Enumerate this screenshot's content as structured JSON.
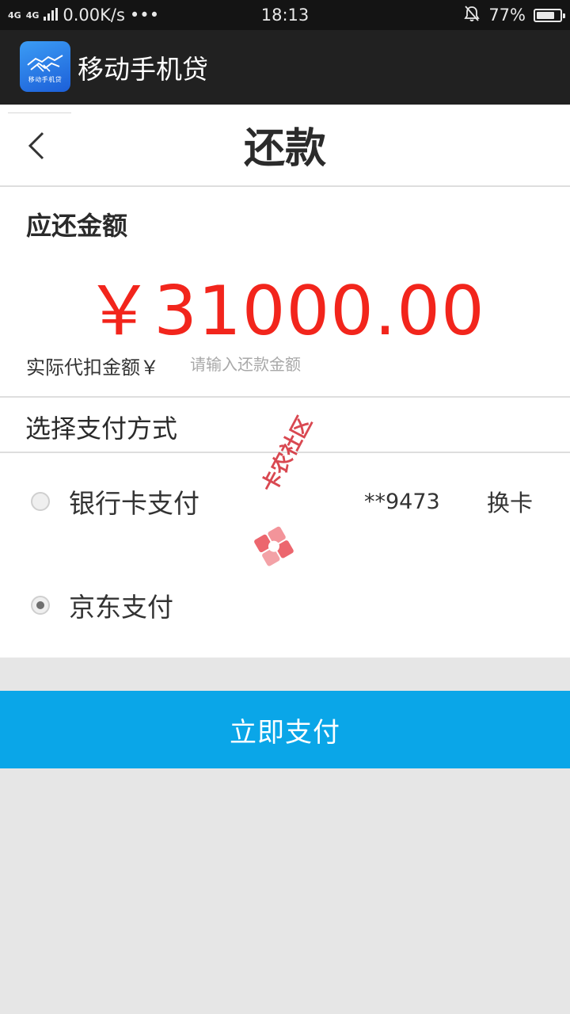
{
  "status_bar": {
    "network": "4G",
    "network2": "4G",
    "speed": "0.00K/s",
    "more": "•••",
    "time": "18:13",
    "battery": "77%",
    "battery_level": 0.77
  },
  "app_bar": {
    "title": "移动手机贷",
    "logo_text": "移动手机贷"
  },
  "page": {
    "title": "还款"
  },
  "amount": {
    "label": "应还金额",
    "value": "￥31000.00",
    "actual_label": "实际代扣金额￥",
    "actual_input_value": "",
    "actual_placeholder": "请输入还款金额"
  },
  "payment": {
    "header": "选择支付方式",
    "options": [
      {
        "label": "银行卡支付",
        "card_number": "**9473",
        "change_label": "换卡",
        "selected": false
      },
      {
        "label": "京东支付",
        "selected": true
      }
    ],
    "pay_button": "立即支付"
  },
  "watermark": {
    "text": "卡农社区"
  },
  "colors": {
    "accent": "#0aa6e8",
    "amount": "#f2251c",
    "app_bar": "#212121",
    "status_bar": "#141414"
  }
}
